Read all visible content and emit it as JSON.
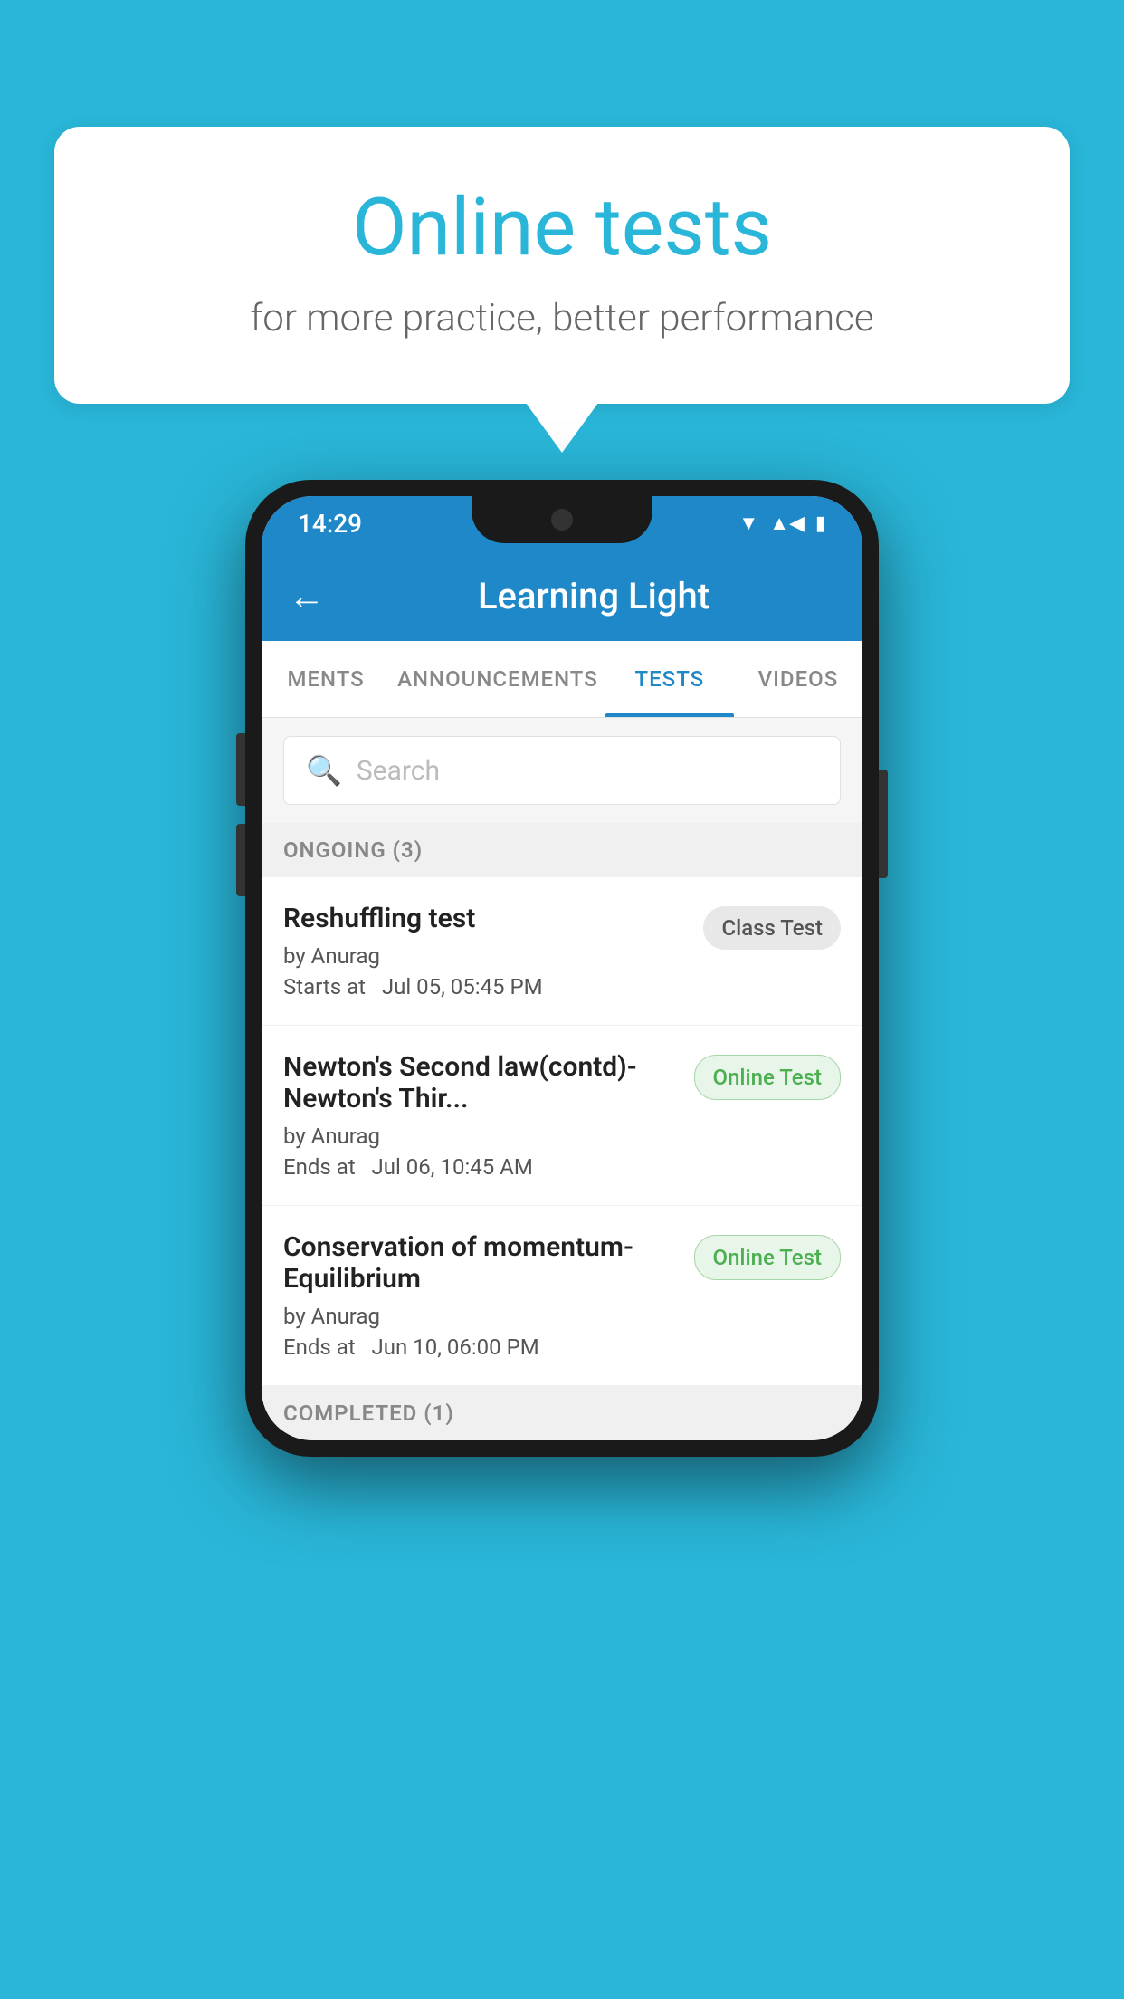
{
  "background_color": "#29b6d8",
  "speech_bubble": {
    "title": "Online tests",
    "subtitle": "for more practice, better performance"
  },
  "phone": {
    "status_bar": {
      "time": "14:29",
      "wifi": "▼",
      "signal": "▲",
      "battery": "▪"
    },
    "app_bar": {
      "back_label": "←",
      "title": "Learning Light"
    },
    "tabs": [
      {
        "label": "MENTS",
        "active": false
      },
      {
        "label": "ANNOUNCEMENTS",
        "active": false
      },
      {
        "label": "TESTS",
        "active": true
      },
      {
        "label": "VIDEOS",
        "active": false
      }
    ],
    "search": {
      "placeholder": "Search"
    },
    "ongoing_section": {
      "label": "ONGOING (3)"
    },
    "tests": [
      {
        "name": "Reshuffling test",
        "author": "by Anurag",
        "time_label": "Starts at",
        "time": "Jul 05, 05:45 PM",
        "badge": "Class Test",
        "badge_type": "class"
      },
      {
        "name": "Newton's Second law(contd)-Newton's Thir...",
        "author": "by Anurag",
        "time_label": "Ends at",
        "time": "Jul 06, 10:45 AM",
        "badge": "Online Test",
        "badge_type": "online"
      },
      {
        "name": "Conservation of momentum-Equilibrium",
        "author": "by Anurag",
        "time_label": "Ends at",
        "time": "Jun 10, 06:00 PM",
        "badge": "Online Test",
        "badge_type": "online"
      }
    ],
    "completed_section": {
      "label": "COMPLETED (1)"
    }
  }
}
